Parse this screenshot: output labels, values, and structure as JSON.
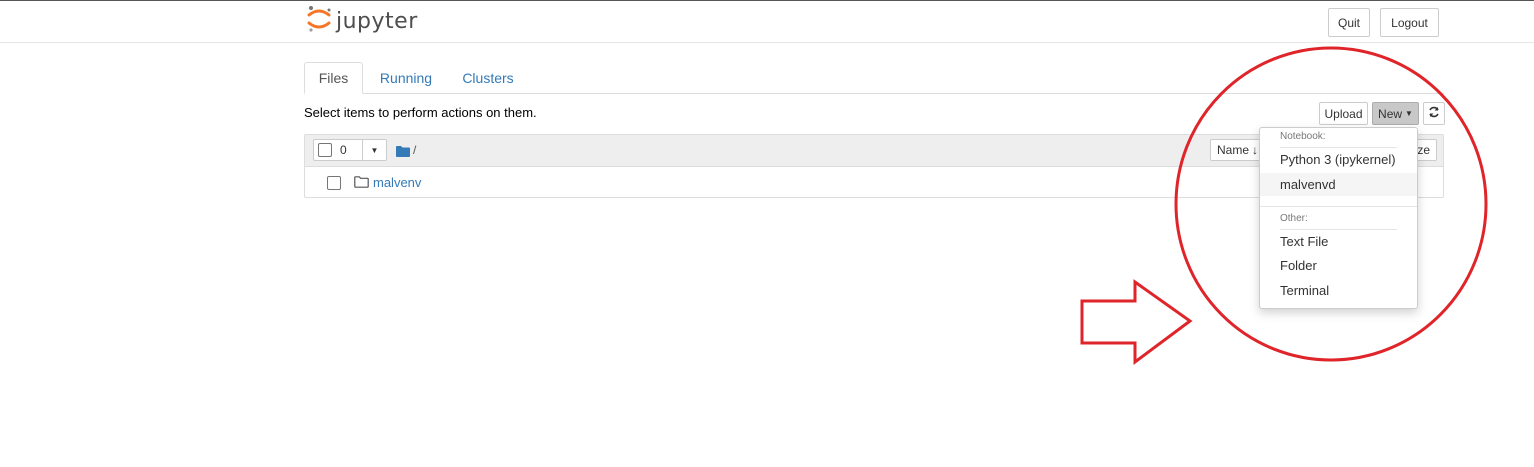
{
  "header": {
    "logo_text": "jupyter",
    "quit_label": "Quit",
    "logout_label": "Logout"
  },
  "tabs": [
    {
      "label": "Files",
      "active": true
    },
    {
      "label": "Running",
      "active": false
    },
    {
      "label": "Clusters",
      "active": false
    }
  ],
  "toolbar": {
    "info_text": "Select items to perform actions on them.",
    "upload_label": "Upload",
    "new_label": "New",
    "refresh_icon": "refresh-icon"
  },
  "file_list": {
    "selected_count": "0",
    "breadcrumb_path": "/",
    "sort_name_label": "Name",
    "sort_truncated_suffix": "ze",
    "items": [
      {
        "name": "malvenv",
        "type": "folder"
      }
    ]
  },
  "new_menu": {
    "notebook_header": "Notebook:",
    "notebook_items": [
      "Python 3 (ipykernel)",
      "malvenvd"
    ],
    "other_header": "Other:",
    "other_items": [
      "Text File",
      "Folder",
      "Terminal"
    ]
  },
  "colors": {
    "accent": "#337ab7",
    "logo_orange": "#f37726",
    "annotation_red": "#e0252a"
  }
}
